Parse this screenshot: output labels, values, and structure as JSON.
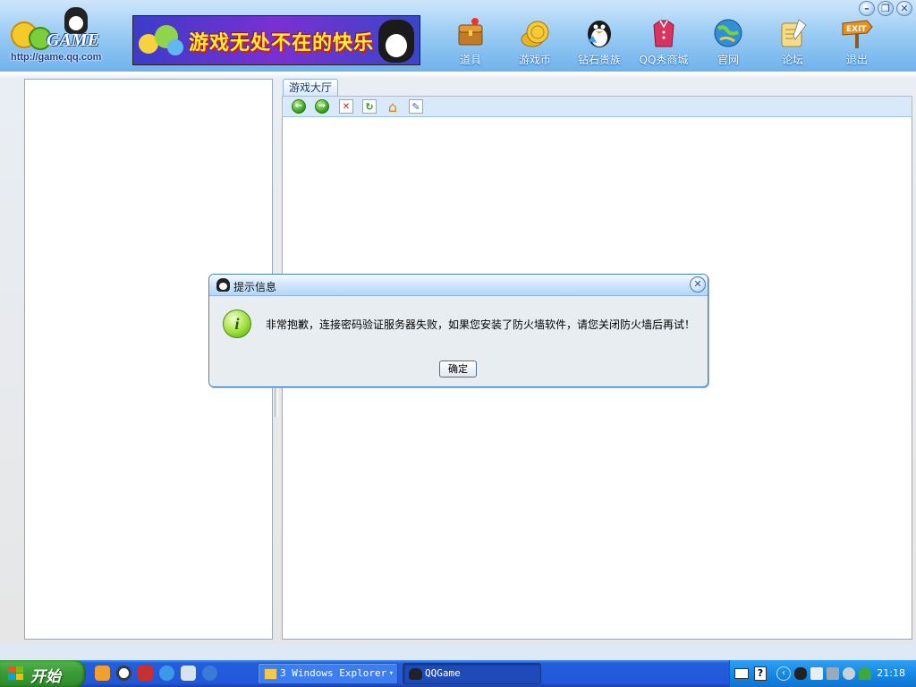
{
  "header": {
    "logo_url_text": "http://game.qq.com",
    "logo_brand": "GAME",
    "banner_text": "游戏无处不在的快乐",
    "nav": [
      {
        "id": "props",
        "label": "道具",
        "icon": "treasure-chest-icon",
        "color": "#d28b2c"
      },
      {
        "id": "coins",
        "label": "游戏币",
        "icon": "gold-coins-icon",
        "color": "#e6b52a"
      },
      {
        "id": "diamond",
        "label": "钻石贵族",
        "icon": "penguin-diamond-icon",
        "color": "#1a1a1a"
      },
      {
        "id": "qqshow",
        "label": "QQ秀商城",
        "icon": "clothing-icon",
        "color": "#d8345f"
      },
      {
        "id": "official",
        "label": "官网",
        "icon": "globe-icon",
        "color": "#2f8fd8"
      },
      {
        "id": "forum",
        "label": "论坛",
        "icon": "scroll-quill-icon",
        "color": "#e0b848"
      },
      {
        "id": "exit",
        "label": "退出",
        "icon": "exit-sign-icon",
        "color": "#e07b1a"
      }
    ],
    "window_buttons": {
      "minimize": "–",
      "restore": "❐",
      "close": "✕"
    }
  },
  "right_panel": {
    "tab_label": "游戏大厅",
    "toolbar": [
      {
        "id": "back",
        "icon": "back-arrow-icon",
        "glyph": "←"
      },
      {
        "id": "forward",
        "icon": "forward-arrow-icon",
        "glyph": "→"
      },
      {
        "id": "stop",
        "icon": "stop-icon",
        "glyph": "✕"
      },
      {
        "id": "refresh",
        "icon": "refresh-icon",
        "glyph": "↻"
      },
      {
        "id": "home",
        "icon": "home-icon",
        "glyph": "⌂"
      },
      {
        "id": "edit",
        "icon": "edit-icon",
        "glyph": "✎"
      }
    ]
  },
  "dialog": {
    "title": "提示信息",
    "message": "非常抱歉，连接密码验证服务器失败，如果您安装了防火墙软件，请您关闭防火墙后再试！",
    "ok_label": "确定",
    "close_glyph": "✕",
    "info_glyph": "i"
  },
  "taskbar": {
    "start_label": "开始",
    "tasks": [
      {
        "id": "explorer",
        "label": "3 Windows Explorer",
        "arrow": "▾"
      },
      {
        "id": "qqgame",
        "label": "QQGame"
      }
    ],
    "tray": {
      "time": "21:18",
      "help_glyph": "?",
      "chevron": "‹"
    }
  }
}
